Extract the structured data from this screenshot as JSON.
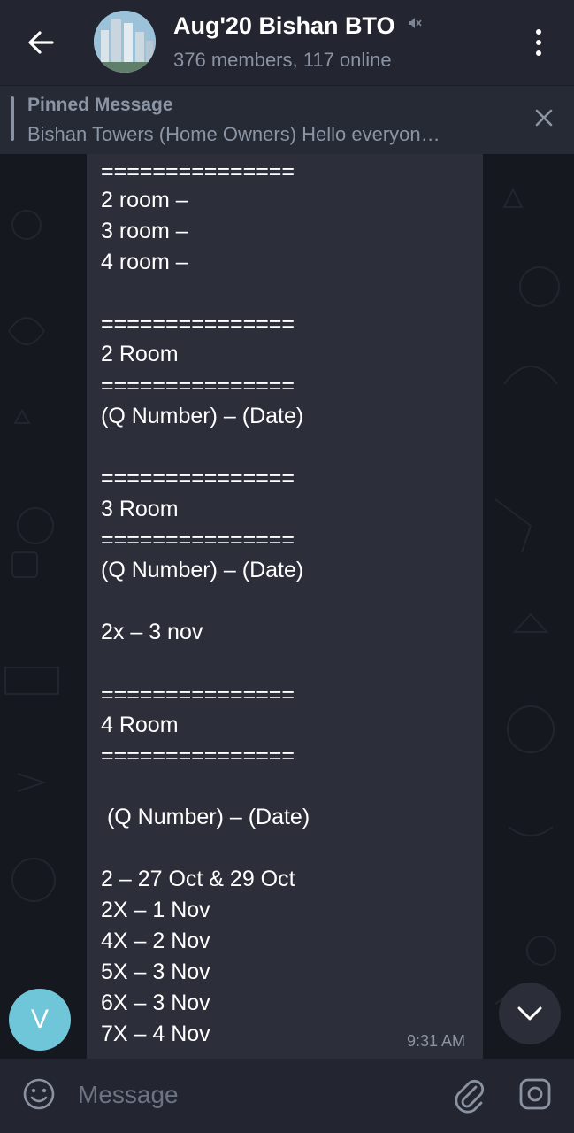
{
  "header": {
    "title": "Aug'20 Bishan BTO",
    "subtitle": "376 members, 117 online",
    "icons": [
      "back-arrow-icon",
      "muted-icon",
      "more-vertical-icon"
    ]
  },
  "pinned": {
    "label": "Pinned Message",
    "text": "Bishan Towers (Home Owners)  Hello everyon…"
  },
  "message": {
    "lines": [
      "===============",
      "2 room –",
      "3 room –",
      "4 room –",
      "",
      "===============",
      "2 Room",
      "===============",
      "(Q Number) – (Date)",
      "",
      "===============",
      "3 Room",
      "===============",
      "(Q Number) – (Date)",
      "",
      "2x – 3 nov",
      "",
      "===============",
      "4 Room",
      "===============",
      "",
      " (Q Number) – (Date)",
      "",
      "2 – 27 Oct & 29 Oct",
      "2X – 1 Nov",
      "4X – 2 Nov",
      "5X – 3 Nov",
      "6X – 3 Nov",
      "7X – 4 Nov"
    ],
    "time": "9:31 AM"
  },
  "sender": {
    "initial": "V",
    "color": "#6fc6d9"
  },
  "composer": {
    "placeholder": "Message"
  },
  "colors": {
    "header_bg": "#232631",
    "bubble_bg": "#2c2f3a",
    "chat_bg": "#16181f",
    "muted_text": "#8b93a3"
  }
}
